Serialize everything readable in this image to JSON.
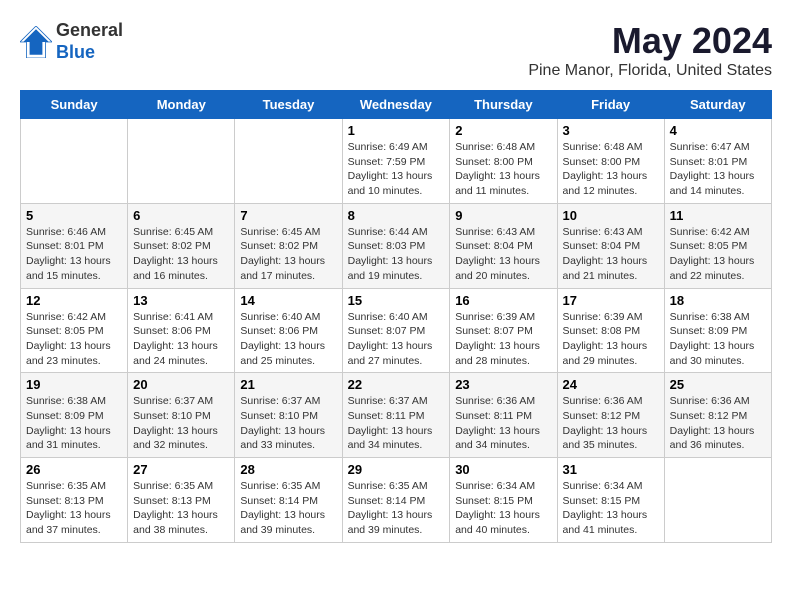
{
  "logo": {
    "general": "General",
    "blue": "Blue"
  },
  "title": "May 2024",
  "subtitle": "Pine Manor, Florida, United States",
  "weekdays": [
    "Sunday",
    "Monday",
    "Tuesday",
    "Wednesday",
    "Thursday",
    "Friday",
    "Saturday"
  ],
  "weeks": [
    [
      {
        "date": "",
        "sunrise": "",
        "sunset": "",
        "daylight": ""
      },
      {
        "date": "",
        "sunrise": "",
        "sunset": "",
        "daylight": ""
      },
      {
        "date": "",
        "sunrise": "",
        "sunset": "",
        "daylight": ""
      },
      {
        "date": "1",
        "sunrise": "Sunrise: 6:49 AM",
        "sunset": "Sunset: 7:59 PM",
        "daylight": "Daylight: 13 hours and 10 minutes."
      },
      {
        "date": "2",
        "sunrise": "Sunrise: 6:48 AM",
        "sunset": "Sunset: 8:00 PM",
        "daylight": "Daylight: 13 hours and 11 minutes."
      },
      {
        "date": "3",
        "sunrise": "Sunrise: 6:48 AM",
        "sunset": "Sunset: 8:00 PM",
        "daylight": "Daylight: 13 hours and 12 minutes."
      },
      {
        "date": "4",
        "sunrise": "Sunrise: 6:47 AM",
        "sunset": "Sunset: 8:01 PM",
        "daylight": "Daylight: 13 hours and 14 minutes."
      }
    ],
    [
      {
        "date": "5",
        "sunrise": "Sunrise: 6:46 AM",
        "sunset": "Sunset: 8:01 PM",
        "daylight": "Daylight: 13 hours and 15 minutes."
      },
      {
        "date": "6",
        "sunrise": "Sunrise: 6:45 AM",
        "sunset": "Sunset: 8:02 PM",
        "daylight": "Daylight: 13 hours and 16 minutes."
      },
      {
        "date": "7",
        "sunrise": "Sunrise: 6:45 AM",
        "sunset": "Sunset: 8:02 PM",
        "daylight": "Daylight: 13 hours and 17 minutes."
      },
      {
        "date": "8",
        "sunrise": "Sunrise: 6:44 AM",
        "sunset": "Sunset: 8:03 PM",
        "daylight": "Daylight: 13 hours and 19 minutes."
      },
      {
        "date": "9",
        "sunrise": "Sunrise: 6:43 AM",
        "sunset": "Sunset: 8:04 PM",
        "daylight": "Daylight: 13 hours and 20 minutes."
      },
      {
        "date": "10",
        "sunrise": "Sunrise: 6:43 AM",
        "sunset": "Sunset: 8:04 PM",
        "daylight": "Daylight: 13 hours and 21 minutes."
      },
      {
        "date": "11",
        "sunrise": "Sunrise: 6:42 AM",
        "sunset": "Sunset: 8:05 PM",
        "daylight": "Daylight: 13 hours and 22 minutes."
      }
    ],
    [
      {
        "date": "12",
        "sunrise": "Sunrise: 6:42 AM",
        "sunset": "Sunset: 8:05 PM",
        "daylight": "Daylight: 13 hours and 23 minutes."
      },
      {
        "date": "13",
        "sunrise": "Sunrise: 6:41 AM",
        "sunset": "Sunset: 8:06 PM",
        "daylight": "Daylight: 13 hours and 24 minutes."
      },
      {
        "date": "14",
        "sunrise": "Sunrise: 6:40 AM",
        "sunset": "Sunset: 8:06 PM",
        "daylight": "Daylight: 13 hours and 25 minutes."
      },
      {
        "date": "15",
        "sunrise": "Sunrise: 6:40 AM",
        "sunset": "Sunset: 8:07 PM",
        "daylight": "Daylight: 13 hours and 27 minutes."
      },
      {
        "date": "16",
        "sunrise": "Sunrise: 6:39 AM",
        "sunset": "Sunset: 8:07 PM",
        "daylight": "Daylight: 13 hours and 28 minutes."
      },
      {
        "date": "17",
        "sunrise": "Sunrise: 6:39 AM",
        "sunset": "Sunset: 8:08 PM",
        "daylight": "Daylight: 13 hours and 29 minutes."
      },
      {
        "date": "18",
        "sunrise": "Sunrise: 6:38 AM",
        "sunset": "Sunset: 8:09 PM",
        "daylight": "Daylight: 13 hours and 30 minutes."
      }
    ],
    [
      {
        "date": "19",
        "sunrise": "Sunrise: 6:38 AM",
        "sunset": "Sunset: 8:09 PM",
        "daylight": "Daylight: 13 hours and 31 minutes."
      },
      {
        "date": "20",
        "sunrise": "Sunrise: 6:37 AM",
        "sunset": "Sunset: 8:10 PM",
        "daylight": "Daylight: 13 hours and 32 minutes."
      },
      {
        "date": "21",
        "sunrise": "Sunrise: 6:37 AM",
        "sunset": "Sunset: 8:10 PM",
        "daylight": "Daylight: 13 hours and 33 minutes."
      },
      {
        "date": "22",
        "sunrise": "Sunrise: 6:37 AM",
        "sunset": "Sunset: 8:11 PM",
        "daylight": "Daylight: 13 hours and 34 minutes."
      },
      {
        "date": "23",
        "sunrise": "Sunrise: 6:36 AM",
        "sunset": "Sunset: 8:11 PM",
        "daylight": "Daylight: 13 hours and 34 minutes."
      },
      {
        "date": "24",
        "sunrise": "Sunrise: 6:36 AM",
        "sunset": "Sunset: 8:12 PM",
        "daylight": "Daylight: 13 hours and 35 minutes."
      },
      {
        "date": "25",
        "sunrise": "Sunrise: 6:36 AM",
        "sunset": "Sunset: 8:12 PM",
        "daylight": "Daylight: 13 hours and 36 minutes."
      }
    ],
    [
      {
        "date": "26",
        "sunrise": "Sunrise: 6:35 AM",
        "sunset": "Sunset: 8:13 PM",
        "daylight": "Daylight: 13 hours and 37 minutes."
      },
      {
        "date": "27",
        "sunrise": "Sunrise: 6:35 AM",
        "sunset": "Sunset: 8:13 PM",
        "daylight": "Daylight: 13 hours and 38 minutes."
      },
      {
        "date": "28",
        "sunrise": "Sunrise: 6:35 AM",
        "sunset": "Sunset: 8:14 PM",
        "daylight": "Daylight: 13 hours and 39 minutes."
      },
      {
        "date": "29",
        "sunrise": "Sunrise: 6:35 AM",
        "sunset": "Sunset: 8:14 PM",
        "daylight": "Daylight: 13 hours and 39 minutes."
      },
      {
        "date": "30",
        "sunrise": "Sunrise: 6:34 AM",
        "sunset": "Sunset: 8:15 PM",
        "daylight": "Daylight: 13 hours and 40 minutes."
      },
      {
        "date": "31",
        "sunrise": "Sunrise: 6:34 AM",
        "sunset": "Sunset: 8:15 PM",
        "daylight": "Daylight: 13 hours and 41 minutes."
      },
      {
        "date": "",
        "sunrise": "",
        "sunset": "",
        "daylight": ""
      }
    ]
  ]
}
